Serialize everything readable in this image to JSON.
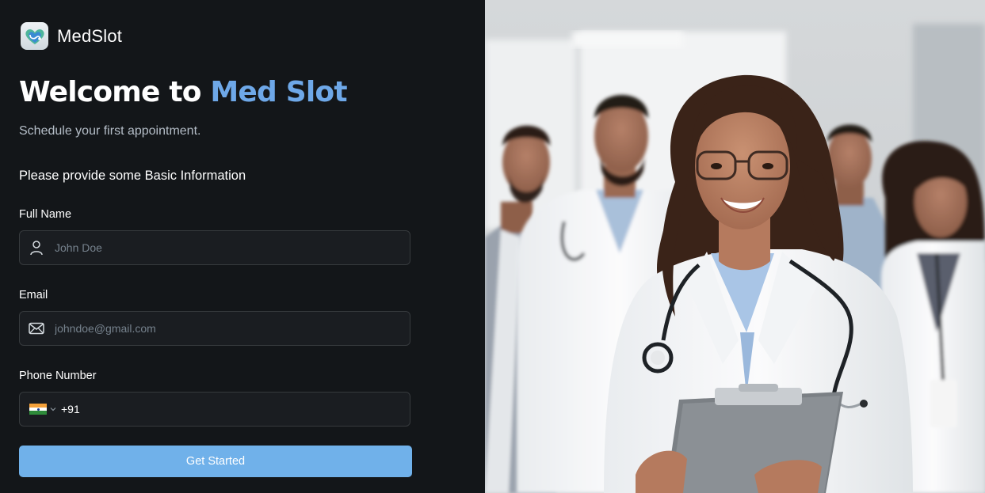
{
  "brand": {
    "name": "MedSlot",
    "logo_icon": "heart-stethoscope-icon"
  },
  "heading": {
    "prefix": "Welcome to",
    "accent": "Med Slot"
  },
  "subtitle": "Schedule your first appointment.",
  "section_title": "Please provide some Basic Information",
  "form": {
    "full_name": {
      "label": "Full Name",
      "placeholder": "John Doe",
      "value": "",
      "icon": "user-icon"
    },
    "email": {
      "label": "Email",
      "placeholder": "johndoe@gmail.com",
      "value": "",
      "icon": "mail-icon"
    },
    "phone": {
      "label": "Phone Number",
      "country_flag": "india-flag-icon",
      "dial_code": "+91",
      "value": ""
    },
    "submit_label": "Get Started"
  },
  "colors": {
    "background": "#131619",
    "accent": "#6ea8e8",
    "button": "#70b1ea",
    "input_bg": "#1a1d21",
    "input_border": "#363a3d"
  },
  "hero_image": {
    "icon": "doctors-photo"
  }
}
